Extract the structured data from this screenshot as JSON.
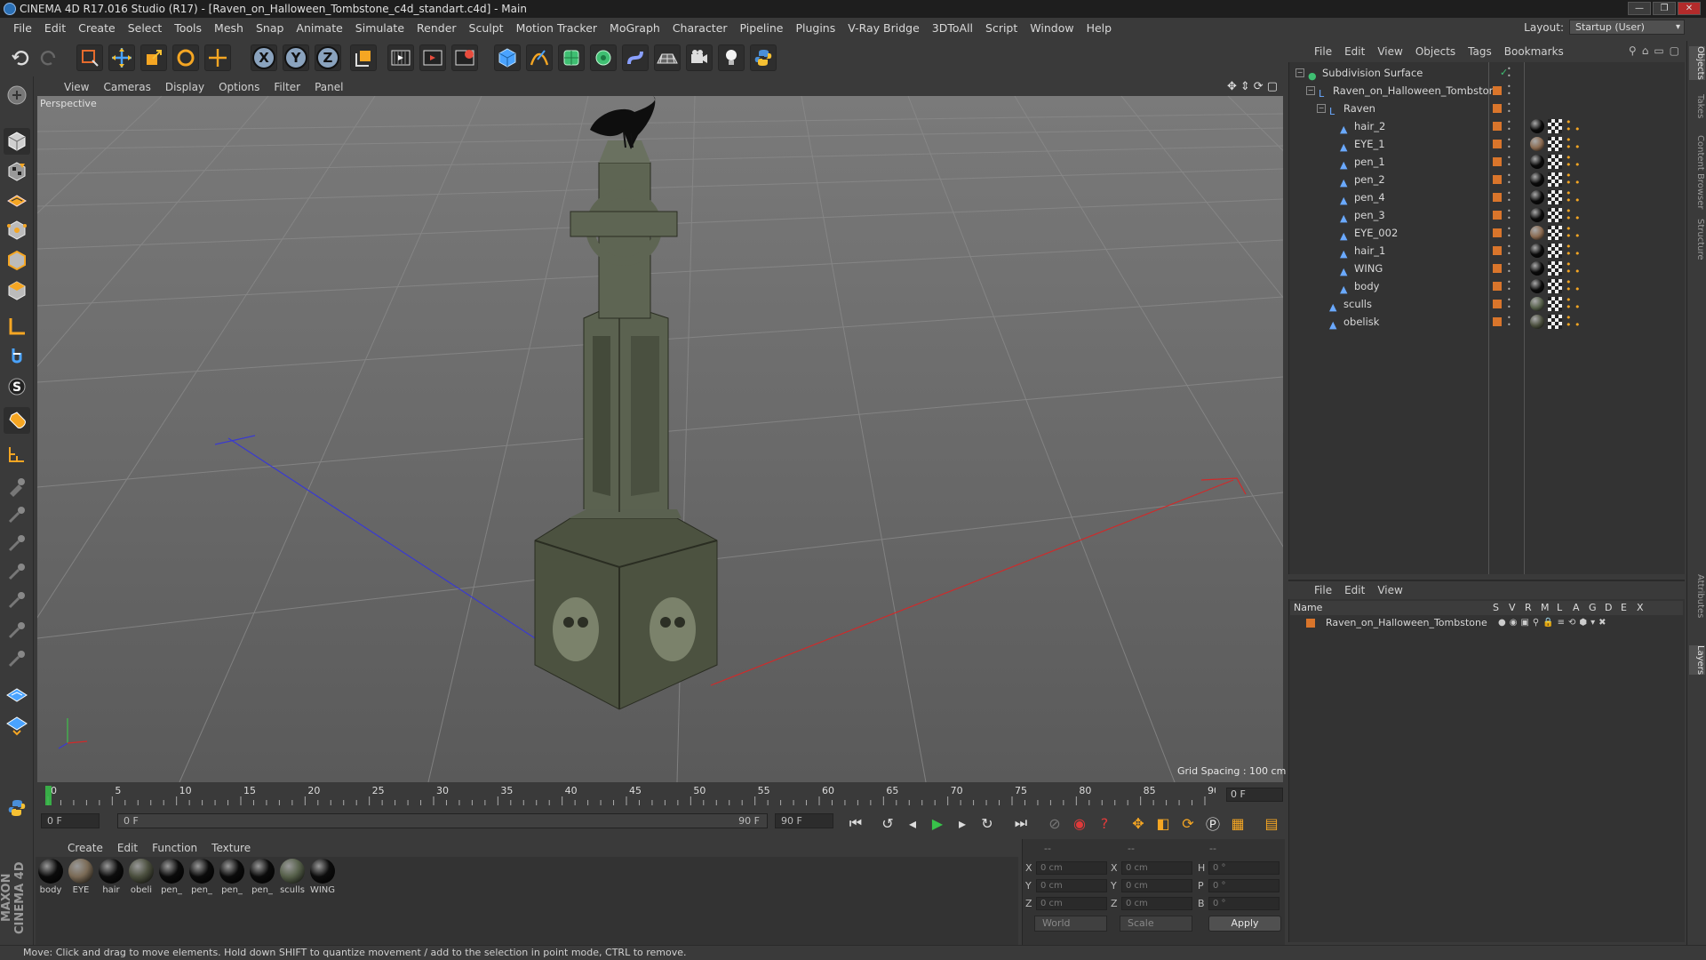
{
  "window": {
    "title": "CINEMA 4D R17.016 Studio (R17) - [Raven_on_Halloween_Tombstone_c4d_standart.c4d] - Main"
  },
  "menubar": {
    "items": [
      "File",
      "Edit",
      "Create",
      "Select",
      "Tools",
      "Mesh",
      "Snap",
      "Animate",
      "Simulate",
      "Render",
      "Sculpt",
      "Motion Tracker",
      "MoGraph",
      "Character",
      "Pipeline",
      "Plugins",
      "V-Ray Bridge",
      "3DToAll",
      "Script",
      "Window",
      "Help"
    ],
    "layout_label": "Layout:",
    "layout_value": "Startup (User)"
  },
  "toolbar": {
    "axis_x": "X",
    "axis_y": "Y",
    "axis_z": "Z"
  },
  "viewport": {
    "menu": [
      "View",
      "Cameras",
      "Display",
      "Options",
      "Filter",
      "Panel"
    ],
    "label": "Perspective",
    "grid_spacing": "Grid Spacing : 100 cm"
  },
  "timeline": {
    "ticks": [
      "0",
      "5",
      "10",
      "15",
      "20",
      "25",
      "30",
      "35",
      "40",
      "45",
      "50",
      "55",
      "60",
      "65",
      "70",
      "75",
      "80",
      "85",
      "90"
    ],
    "current_frame": "0 F",
    "start_field": "0 F",
    "range_start": "0 F",
    "range_end": "90 F",
    "end_field": "90 F"
  },
  "materials": {
    "menu": [
      "Create",
      "Edit",
      "Function",
      "Texture"
    ],
    "items": [
      {
        "label": "body",
        "color": "#0b0b0b"
      },
      {
        "label": "EYE",
        "color": "#7a6a55"
      },
      {
        "label": "hair",
        "color": "#0d0d0d"
      },
      {
        "label": "obeli",
        "color": "#4b4f3e"
      },
      {
        "label": "pen_",
        "color": "#0b0b0b"
      },
      {
        "label": "pen_",
        "color": "#0b0b0b"
      },
      {
        "label": "pen_",
        "color": "#0b0b0b"
      },
      {
        "label": "pen_",
        "color": "#0b0b0b"
      },
      {
        "label": "sculls",
        "color": "#56604a"
      },
      {
        "label": "WING",
        "color": "#0c0c0c"
      }
    ]
  },
  "coordinates": {
    "header": [
      "--",
      "--",
      "--"
    ],
    "rows": [
      {
        "a": "X",
        "av": "0 cm",
        "b": "X",
        "bv": "0 cm",
        "c": "H",
        "cv": "0 °"
      },
      {
        "a": "Y",
        "av": "0 cm",
        "b": "Y",
        "bv": "0 cm",
        "c": "P",
        "cv": "0 °"
      },
      {
        "a": "Z",
        "av": "0 cm",
        "b": "Z",
        "bv": "0 cm",
        "c": "B",
        "cv": "0 °"
      }
    ],
    "world": "World",
    "scale": "Scale",
    "apply": "Apply"
  },
  "objects": {
    "menu": [
      "File",
      "Edit",
      "View",
      "Objects",
      "Tags",
      "Bookmarks"
    ],
    "rows": [
      {
        "name": "Subdivision Surface",
        "indent": 0,
        "type": "subdiv"
      },
      {
        "name": "Raven_on_Halloween_Tombstone",
        "indent": 1,
        "type": "null"
      },
      {
        "name": "Raven",
        "indent": 2,
        "type": "null"
      },
      {
        "name": "hair_2",
        "indent": 3,
        "type": "poly",
        "tag": "#0b0b0b"
      },
      {
        "name": "EYE_1",
        "indent": 3,
        "type": "poly",
        "tag": "#8a6a50"
      },
      {
        "name": "pen_1",
        "indent": 3,
        "type": "poly",
        "tag": "#0b0b0b"
      },
      {
        "name": "pen_2",
        "indent": 3,
        "type": "poly",
        "tag": "#0b0b0b"
      },
      {
        "name": "pen_4",
        "indent": 3,
        "type": "poly",
        "tag": "#0b0b0b"
      },
      {
        "name": "pen_3",
        "indent": 3,
        "type": "poly",
        "tag": "#0b0b0b"
      },
      {
        "name": "EYE_002",
        "indent": 3,
        "type": "poly",
        "tag": "#8a6a50"
      },
      {
        "name": "hair_1",
        "indent": 3,
        "type": "poly",
        "tag": "#0b0b0b"
      },
      {
        "name": "WING",
        "indent": 3,
        "type": "poly",
        "tag": "#0b0b0b"
      },
      {
        "name": "body",
        "indent": 3,
        "type": "poly",
        "tag": "#0b0b0b"
      },
      {
        "name": "sculls",
        "indent": 2,
        "type": "poly",
        "tag": "#56604a"
      },
      {
        "name": "obelisk",
        "indent": 2,
        "type": "poly",
        "tag": "#4b4f3e"
      }
    ]
  },
  "layers": {
    "menu": [
      "File",
      "Edit",
      "View"
    ],
    "header_name": "Name",
    "columns": [
      "S",
      "V",
      "R",
      "M",
      "L",
      "A",
      "G",
      "D",
      "E",
      "X"
    ],
    "row_name": "Raven_on_Halloween_Tombstone"
  },
  "right_tabs": [
    "Objects",
    "Takes",
    "Content Browser",
    "Structure",
    "Attributes",
    "Layers"
  ],
  "status": "Move: Click and drag to move elements. Hold down SHIFT to quantize movement / add to the selection in point mode, CTRL to remove.",
  "brand": "MAXON CINEMA 4D",
  "colors": {
    "accent": "#d9752b",
    "object_icon": "#6aa9ff",
    "play": "#38c24a"
  }
}
